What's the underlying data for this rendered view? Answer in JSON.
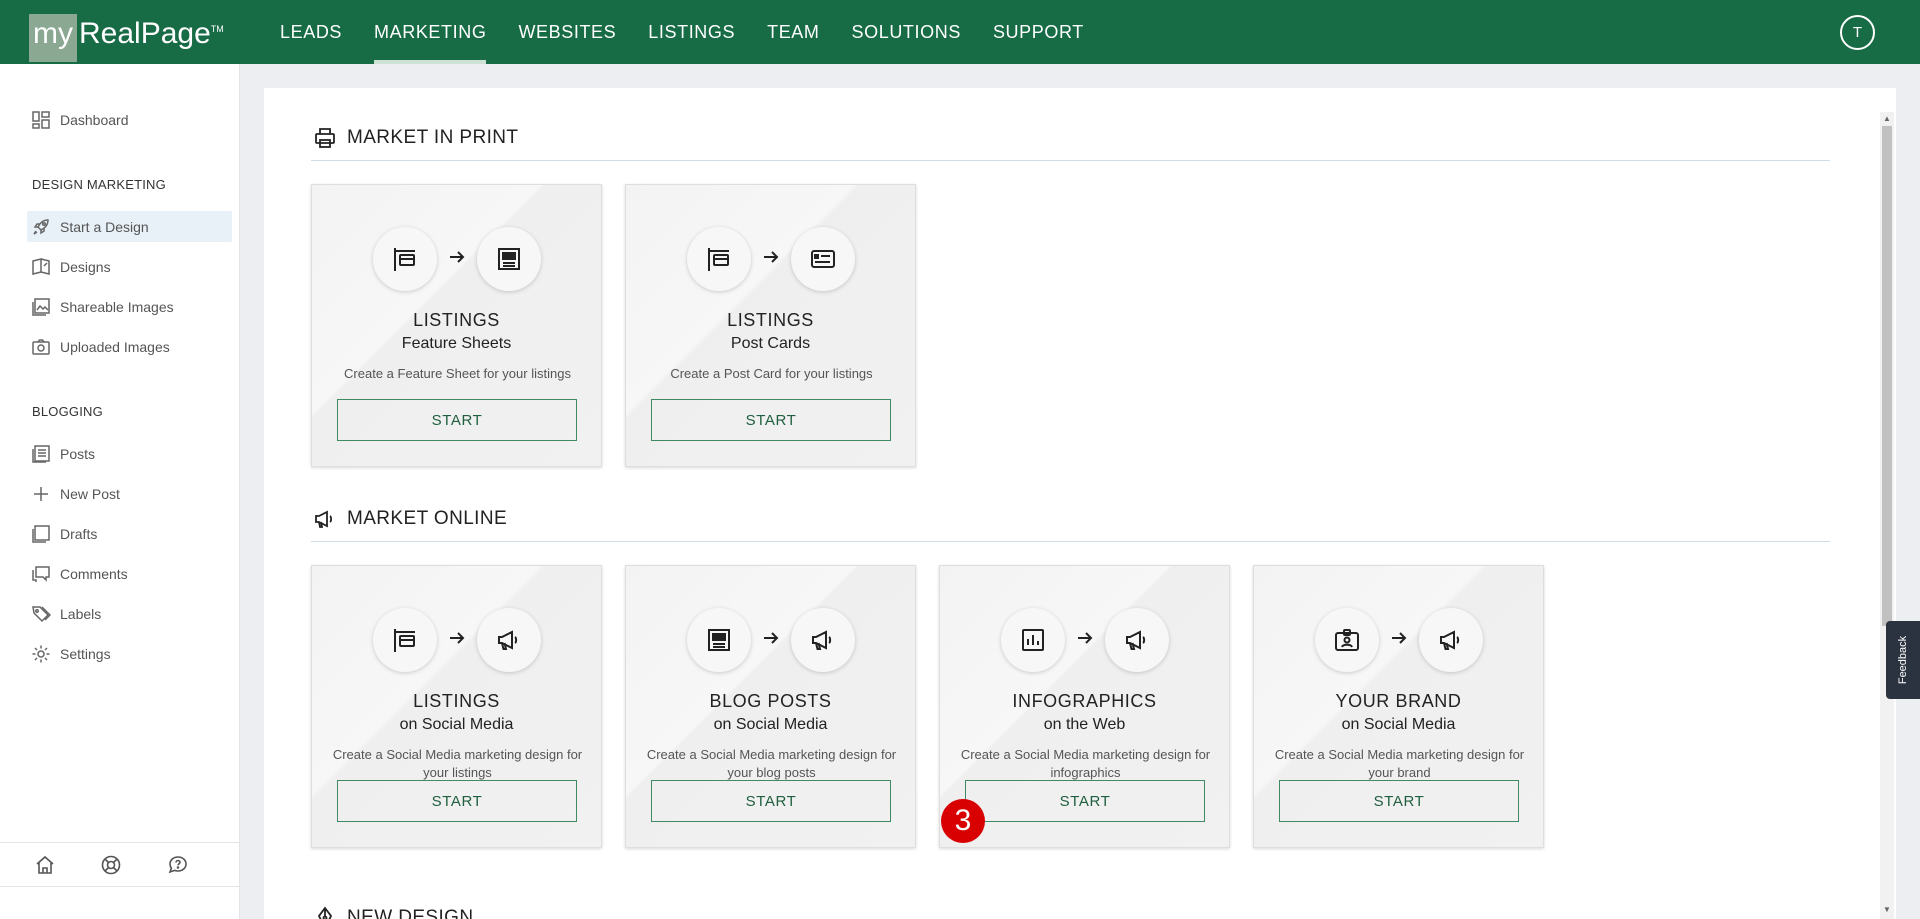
{
  "app": {
    "logo_my": "my",
    "logo_name": "RealPage",
    "logo_tm": "TM",
    "avatar_initial": "T"
  },
  "nav": [
    {
      "label": "LEADS"
    },
    {
      "label": "MARKETING",
      "active": true
    },
    {
      "label": "WEBSITES"
    },
    {
      "label": "LISTINGS"
    },
    {
      "label": "TEAM"
    },
    {
      "label": "SOLUTIONS"
    },
    {
      "label": "SUPPORT"
    }
  ],
  "sidebar": {
    "dashboard": "Dashboard",
    "design_heading": "DESIGN MARKETING",
    "design_items": [
      {
        "label": "Start a Design",
        "icon": "rocket-icon",
        "active": true
      },
      {
        "label": "Designs",
        "icon": "book-icon"
      },
      {
        "label": "Shareable Images",
        "icon": "image-icon"
      },
      {
        "label": "Uploaded Images",
        "icon": "camera-icon"
      }
    ],
    "blogging_heading": "BLOGGING",
    "blog_items": [
      {
        "label": "Posts",
        "icon": "posts-icon"
      },
      {
        "label": "New Post",
        "icon": "plus-icon"
      },
      {
        "label": "Drafts",
        "icon": "drafts-icon"
      },
      {
        "label": "Comments",
        "icon": "comments-icon"
      },
      {
        "label": "Labels",
        "icon": "tag-icon"
      },
      {
        "label": "Settings",
        "icon": "gear-icon"
      }
    ]
  },
  "sections": {
    "print_title": "MARKET IN PRINT",
    "online_title": "MARKET ONLINE",
    "new_design_title": "NEW DESIGN"
  },
  "print_cards": [
    {
      "title": "LISTINGS",
      "subtitle": "Feature Sheets",
      "desc": "Create a Feature Sheet for your listings",
      "button": "START"
    },
    {
      "title": "LISTINGS",
      "subtitle": "Post Cards",
      "desc": "Create a Post Card for your listings",
      "button": "START"
    }
  ],
  "online_cards": [
    {
      "title": "LISTINGS",
      "subtitle": "on Social Media",
      "desc": "Create a Social Media marketing design for your listings",
      "button": "START"
    },
    {
      "title": "BLOG POSTS",
      "subtitle": "on Social Media",
      "desc": "Create a Social Media marketing design for your blog posts",
      "button": "START"
    },
    {
      "title": "INFOGRAPHICS",
      "subtitle": "on the Web",
      "desc": "Create a Social Media marketing design for infographics",
      "button": "START"
    },
    {
      "title": "YOUR BRAND",
      "subtitle": "on Social Media",
      "desc": "Create a Social Media marketing design for your brand",
      "button": "START"
    }
  ],
  "badge": "3",
  "feedback": "Feedback",
  "colors": {
    "brand_green": "#176b45",
    "button_border": "#3f8a63",
    "badge_red": "#d80000"
  }
}
